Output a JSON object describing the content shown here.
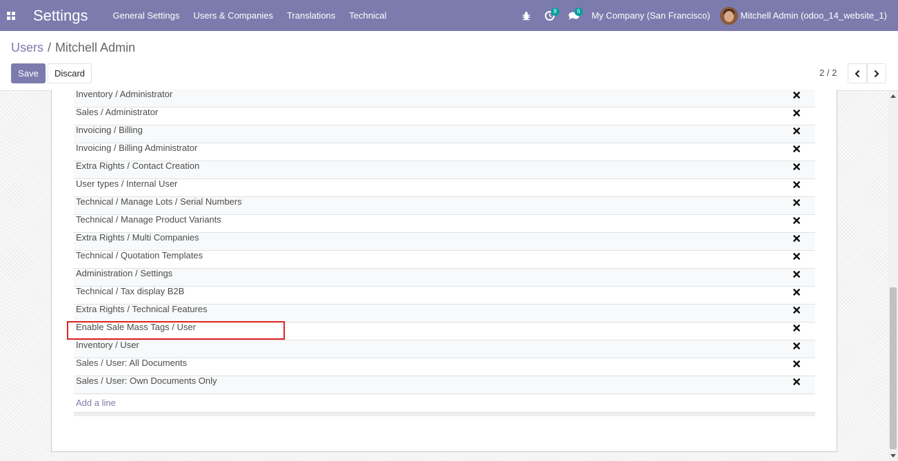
{
  "navbar": {
    "brand": "Settings",
    "menu": [
      "General Settings",
      "Users & Companies",
      "Translations",
      "Technical"
    ],
    "activity_count": "8",
    "message_count": "6",
    "company": "My Company (San Francisco)",
    "user": "Mitchell Admin (odoo_14_website_1)",
    "accent_color": "#7C7BAD"
  },
  "breadcrumb": {
    "parent": "Users",
    "separator": "/",
    "current": "Mitchell Admin"
  },
  "buttons": {
    "save": "Save",
    "discard": "Discard"
  },
  "pager": {
    "value": "2 / 2"
  },
  "groups": [
    "Inventory / Administrator",
    "Sales / Administrator",
    "Invoicing / Billing",
    "Invoicing / Billing Administrator",
    "Extra Rights / Contact Creation",
    "User types / Internal User",
    "Technical / Manage Lots / Serial Numbers",
    "Technical / Manage Product Variants",
    "Extra Rights / Multi Companies",
    "Technical / Quotation Templates",
    "Administration / Settings",
    "Technical / Tax display B2B",
    "Extra Rights / Technical Features",
    "Enable Sale Mass Tags / User",
    "Inventory / User",
    "Sales / User: All Documents",
    "Sales / User: Own Documents Only"
  ],
  "add_line": "Add a line",
  "highlight_color": "#e02020"
}
